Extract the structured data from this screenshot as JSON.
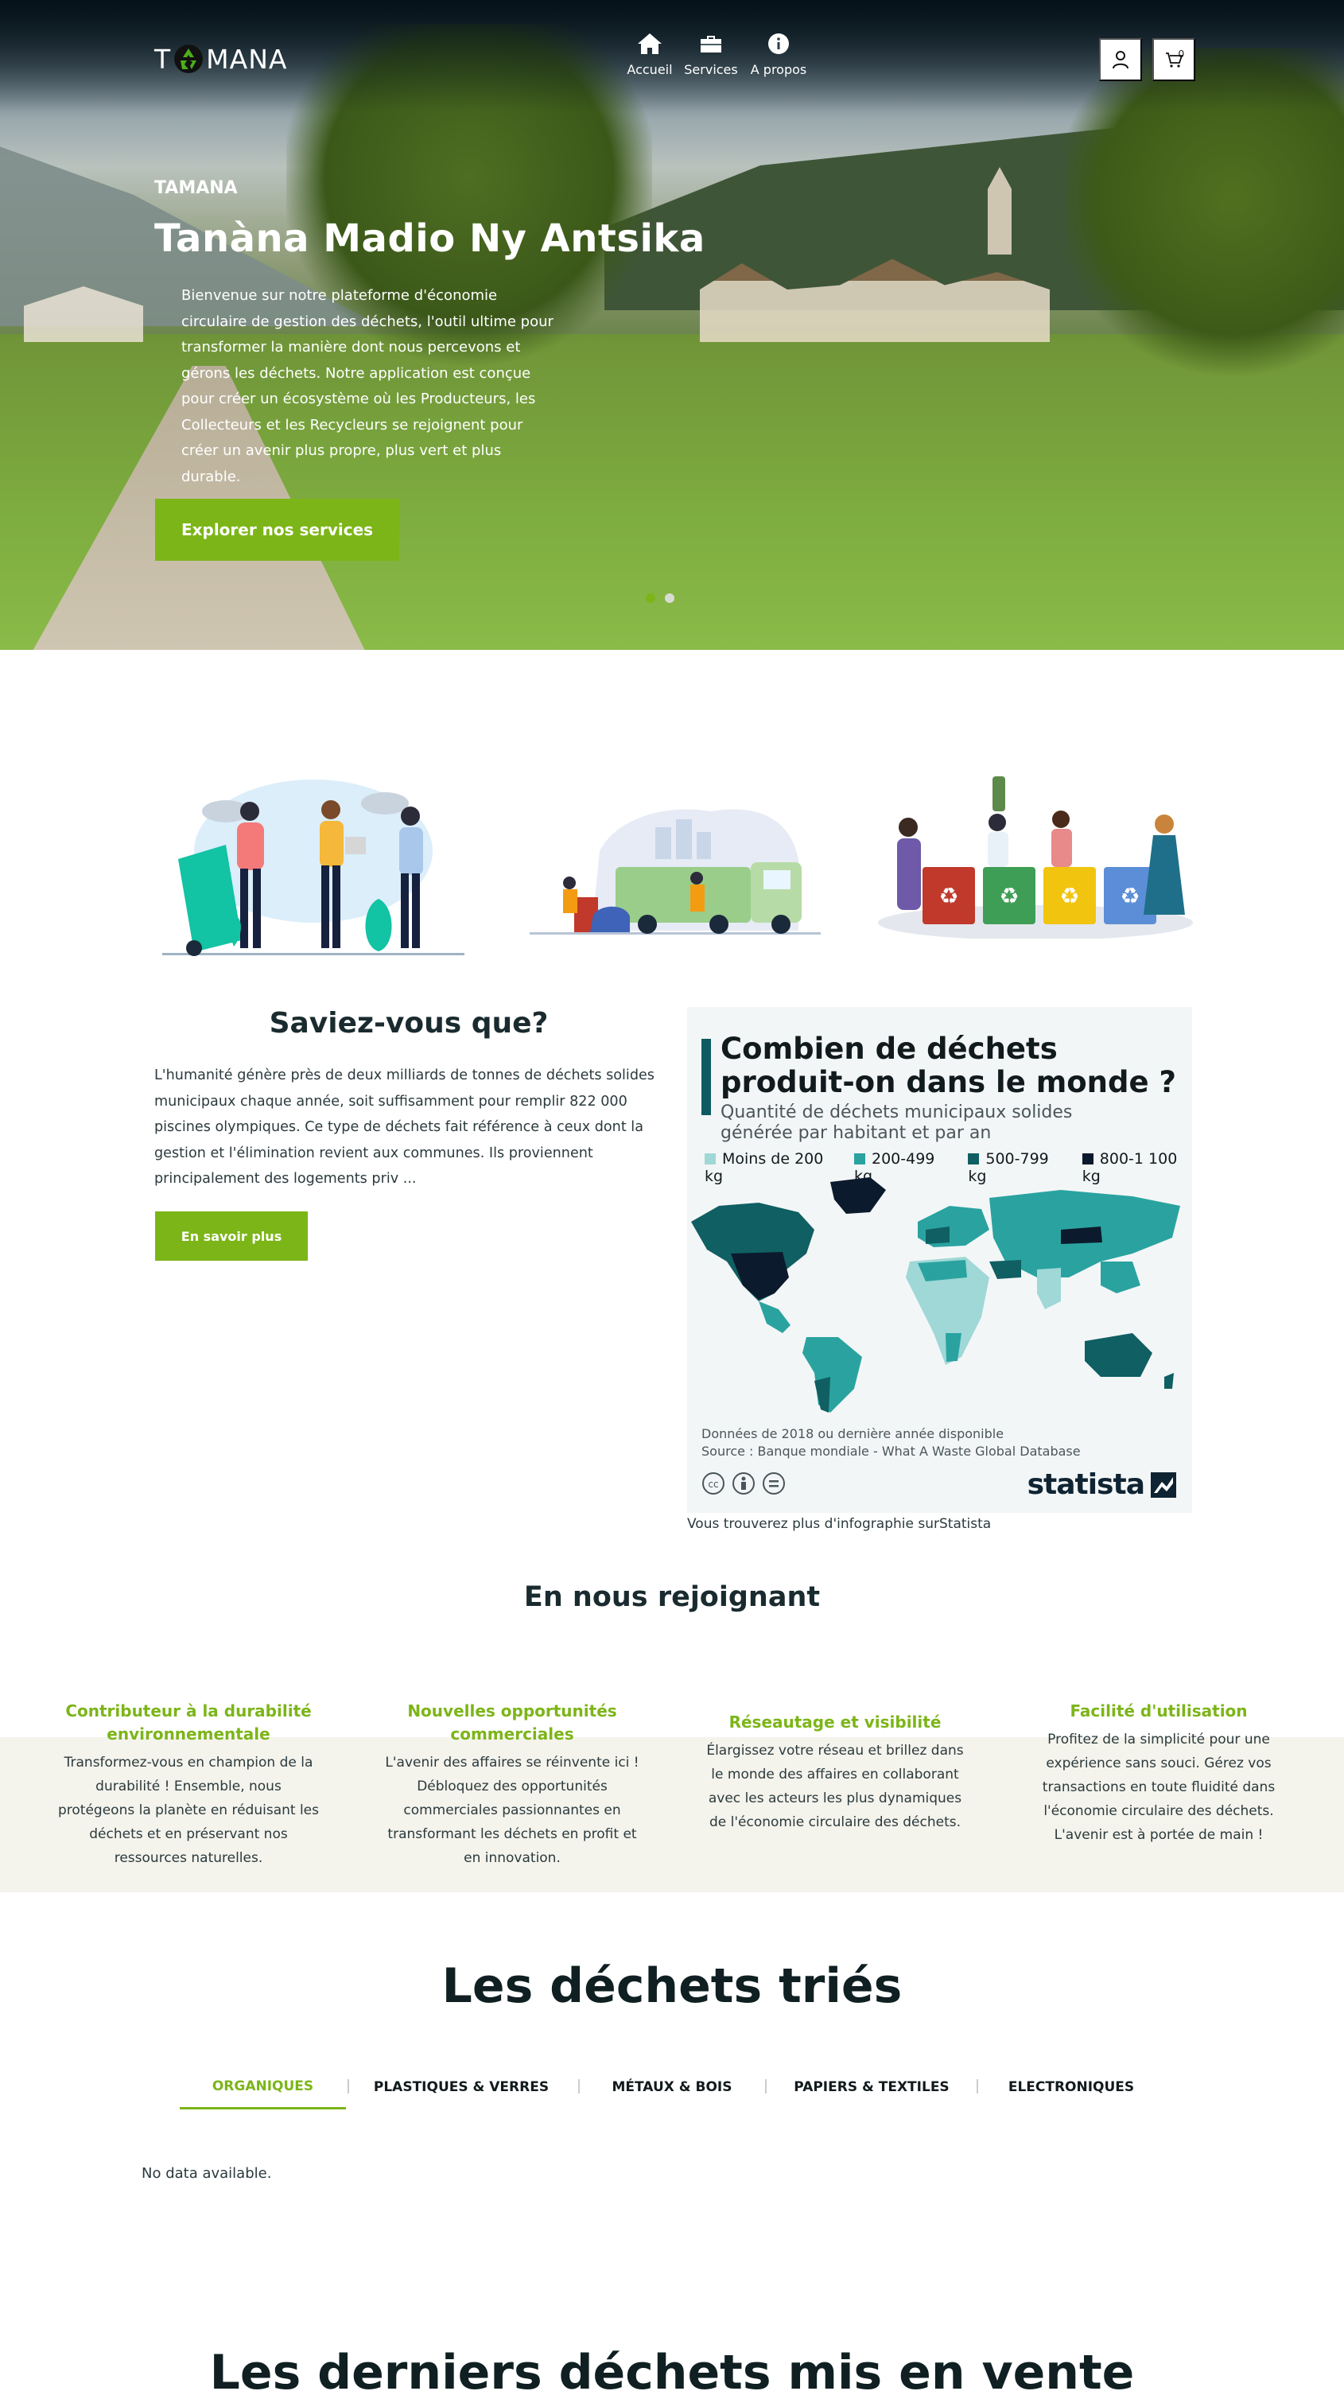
{
  "nav": {
    "logo_text_left": "T",
    "logo_text_right": "MANA",
    "items": [
      {
        "label": "Accueil",
        "icon": "home-icon"
      },
      {
        "label": "Services",
        "icon": "briefcase-icon"
      },
      {
        "label": "A propos",
        "icon": "info-icon"
      }
    ],
    "cart_count": "0"
  },
  "hero": {
    "eyebrow": "TAMANA",
    "title": "Tanàna Madio Ny Antsika",
    "text": "Bienvenue sur notre plateforme d'économie circulaire de gestion des déchets, l'outil ultime pour transformer la manière dont nous percevons et gérons les déchets. Notre application est conçue pour créer un écosystème où les Producteurs, les Collecteurs et les Recycleurs se rejoignent pour créer un avenir plus propre, plus vert et plus durable.",
    "cta": "Explorer nos services",
    "slides": 2,
    "active_slide": 1
  },
  "saviez": {
    "title": "Saviez-vous que?",
    "text": "L'humanité génère près de deux milliards de tonnes de déchets solides municipaux chaque année, soit suffisamment pour remplir 822 000 piscines olympiques. Ce type de déchets fait référence à ceux dont la gestion et l'élimination revient aux communes. Ils proviennent principalement des logements priv ...",
    "button": "En savoir plus"
  },
  "infographic": {
    "title": "Combien de déchets produit-on dans le monde ?",
    "subtitle": "Quantité de déchets municipaux solides générée par habitant et par an",
    "legend": [
      {
        "label": "Moins de 200 kg",
        "color": "#9fd8d6"
      },
      {
        "label": "200-499 kg",
        "color": "#2aa3a0"
      },
      {
        "label": "500-799 kg",
        "color": "#0f5f63"
      },
      {
        "label": "800-1 100 kg",
        "color": "#0b1a2c"
      }
    ],
    "note1": "Données de 2018 ou dernière année disponible",
    "note2": "Source : Banque mondiale - What A Waste Global Database",
    "brand": "statista",
    "caption": "Vous trouverez plus d'infographie surStatista"
  },
  "join": {
    "title": "En nous rejoignant",
    "features": [
      {
        "title": "Contributeur à la durabilité environnementale",
        "text": "Transformez-vous en champion de la durabilité ! Ensemble, nous protégeons la planète en réduisant les déchets et en préservant nos ressources naturelles."
      },
      {
        "title": "Nouvelles opportunités commerciales",
        "text": "L'avenir des affaires se réinvente ici ! Débloquez des opportunités commerciales passionnantes en transformant les déchets en profit et en innovation."
      },
      {
        "title": "Réseautage et visibilité",
        "text": "Élargissez votre réseau et brillez dans le monde des affaires en collaborant avec les acteurs les plus dynamiques de l'économie circulaire des déchets."
      },
      {
        "title": "Facilité d'utilisation",
        "text": "Profitez de la simplicité pour une expérience sans souci. Gérez vos transactions en toute fluidité dans l'économie circulaire des déchets. L'avenir est à portée de main !"
      }
    ]
  },
  "sorted": {
    "title": "Les déchets triés",
    "tabs": [
      "Organiques",
      "Plastiques & verres",
      "Métaux & bois",
      "Papiers & textiles",
      "Electroniques"
    ],
    "active_tab": 0,
    "empty": "No data available."
  },
  "latest": {
    "title": "Les derniers déchets mis en vente"
  },
  "colors": {
    "accent": "#7cb518",
    "dark": "#0f1f22"
  }
}
